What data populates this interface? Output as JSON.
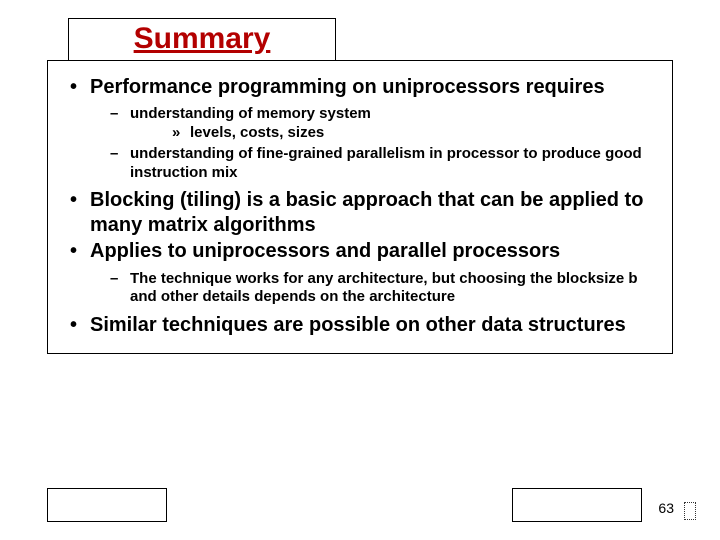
{
  "title": "Summary",
  "bullets": [
    {
      "text": "Performance programming on uniprocessors requires",
      "sub": [
        {
          "text": "understanding of memory system",
          "sub": [
            {
              "text": "levels, costs, sizes"
            }
          ]
        },
        {
          "text": "understanding of fine-grained parallelism in processor to produce good instruction mix"
        }
      ]
    },
    {
      "text": "Blocking (tiling) is a basic approach that can be applied to many matrix algorithms"
    },
    {
      "text": "Applies to uniprocessors and parallel processors",
      "sub": [
        {
          "text": "The technique works for any architecture, but choosing the blocksize b and other details depends on the architecture"
        }
      ]
    },
    {
      "text": "Similar techniques are possible on other data structures"
    }
  ],
  "page_number": "63"
}
